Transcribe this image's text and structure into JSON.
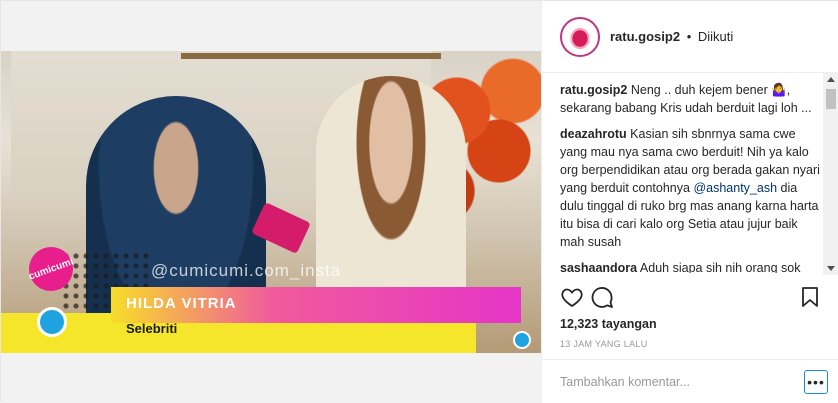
{
  "media": {
    "watermark": "@cumicumi.com_insta",
    "name_banner": "HILDA VITRIA",
    "role_banner": "Selebriti",
    "logo_text": "cumicumi"
  },
  "header": {
    "username": "ratu.gosip2",
    "separator": "•",
    "follow_status": "Diikuti"
  },
  "comments": [
    {
      "user": "ratu.gosip2",
      "text": "Neng .. duh kejem bener 🤷‍♀️, sekarang babang Kris udah berduit lagi loh ..."
    },
    {
      "user": "deazahrotu",
      "text_before": "Kasian sih sbnrnya sama cwe yang mau nya sama cwo berduit! Nih ya kalo org berpendidikan atau org berada gakan nyari yang berduit contohnya",
      "mention": "@ashanty_ash",
      "text_after": "dia dulu tinggal di ruko brg mas anang karna harta itu bisa di cari kalo org Setia atau jujur baik mah susah"
    },
    {
      "user": "sashaandora",
      "text": "Aduh siapa sih nih orang sok ngartis bgt sumpah iiiik sama ni orang"
    }
  ],
  "stats": {
    "views": "12,323 tayangan",
    "time": "13 JAM YANG LALU"
  },
  "add_comment": {
    "placeholder": "Tambahkan komentar...",
    "more_label": "•••"
  },
  "icons": {
    "like": "heart-icon",
    "comment": "comment-icon",
    "save": "bookmark-icon"
  }
}
